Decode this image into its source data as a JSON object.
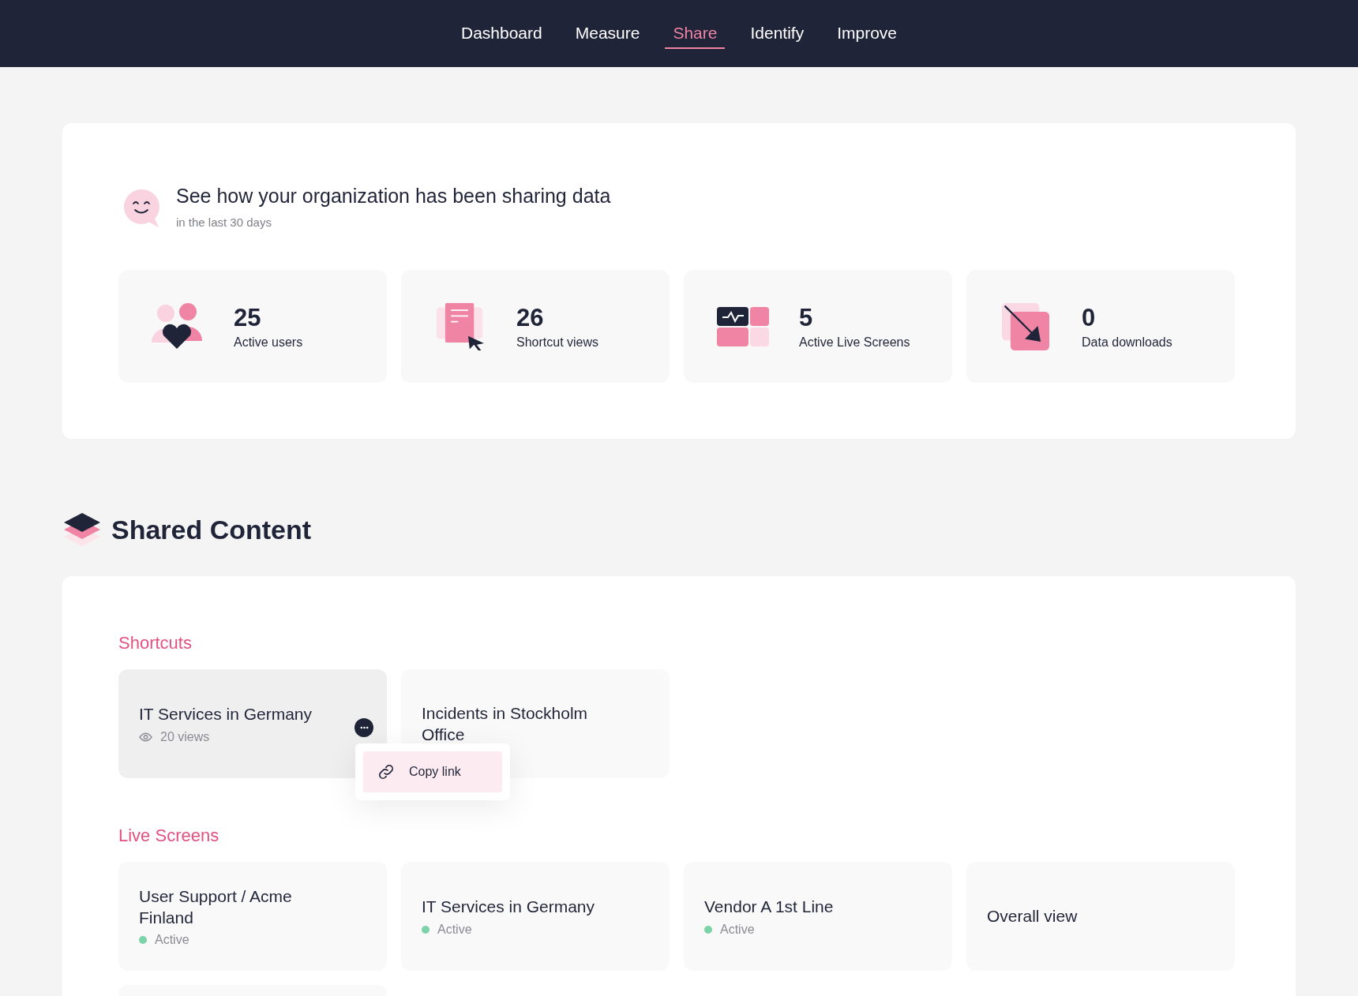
{
  "nav": {
    "tabs": [
      {
        "label": "Dashboard",
        "selected": false
      },
      {
        "label": "Measure",
        "selected": false
      },
      {
        "label": "Share",
        "selected": true
      },
      {
        "label": "Identify",
        "selected": false
      },
      {
        "label": "Improve",
        "selected": false
      }
    ]
  },
  "summary": {
    "title": "See how your organization has been sharing data",
    "subtitle": "in the last 30 days",
    "stats": [
      {
        "kind": "users",
        "value": "25",
        "label": "Active users"
      },
      {
        "kind": "shortcuts",
        "value": "26",
        "label": "Shortcut views"
      },
      {
        "kind": "screens",
        "value": "5",
        "label": "Active Live Screens"
      },
      {
        "kind": "downloads",
        "value": "0",
        "label": "Data downloads"
      }
    ]
  },
  "shared_content": {
    "title": "Shared Content",
    "shortcuts": {
      "title": "Shortcuts",
      "items": [
        {
          "name": "IT Services in Germany",
          "views": "20 views",
          "menu_open": true,
          "menu": [
            {
              "label": "Copy link"
            }
          ]
        },
        {
          "name": "Incidents in Stockholm Office",
          "menu_open": false
        }
      ]
    },
    "live_screens": {
      "title": "Live Screens",
      "items": [
        {
          "name": "User Support / Acme Finland",
          "status": "Active"
        },
        {
          "name": "IT Services in Germany",
          "status": "Active"
        },
        {
          "name": "Vendor A 1st Line",
          "status": "Active"
        },
        {
          "name": "Overall view"
        }
      ]
    }
  }
}
